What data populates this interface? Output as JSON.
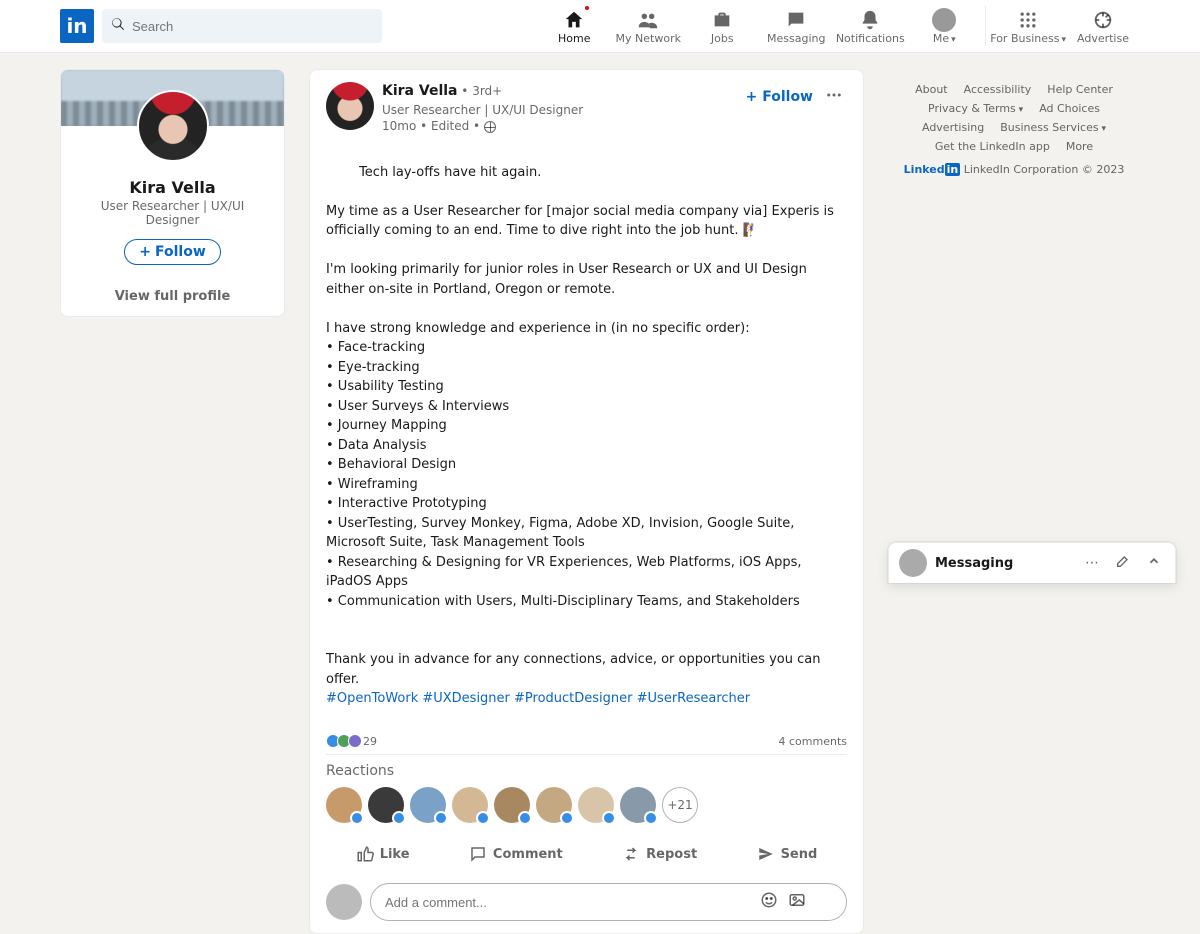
{
  "search": {
    "placeholder": "Search"
  },
  "nav": {
    "home": "Home",
    "network": "My Network",
    "jobs": "Jobs",
    "messaging": "Messaging",
    "notifications": "Notifications",
    "me": "Me",
    "business": "For Business",
    "advertise": "Advertise"
  },
  "profileCard": {
    "name": "Kira Vella",
    "headline": "User Researcher | UX/UI Designer",
    "follow": "Follow",
    "viewFull": "View full profile"
  },
  "post": {
    "author": "Kira Vella",
    "degree": " • 3rd+",
    "headline": "User Researcher | UX/UI Designer",
    "time": "10mo • Edited • ",
    "followLabel": "+ Follow",
    "body": "Tech lay-offs have hit again.\n\nMy time as a User Researcher for [major social media company via] Experis is officially coming to an end. Time to dive right into the job hunt. 🧗‍♀️\n\nI'm looking primarily for junior roles in User Research or UX and UI Design either on-site in Portland, Oregon or remote.\n\nI have strong knowledge and experience in (in no specific order):\n• Face-tracking\n• Eye-tracking\n• Usability Testing\n• User Surveys & Interviews\n• Journey Mapping\n• Data Analysis\n• Behavioral Design\n• Wireframing\n• Interactive Prototyping\n• UserTesting, Survey Monkey, Figma, Adobe XD, Invision, Google Suite, Microsoft Suite, Task Management Tools\n• Researching & Designing for VR Experiences, Web Platforms, iOS Apps, iPadOS Apps\n• Communication with Users, Multi-Disciplinary Teams, and Stakeholders\n\n\nThank you in advance for any connections, advice, or opportunities you can offer.",
    "hashtags": "#OpenToWork #UXDesigner #ProductDesigner #UserResearcher",
    "reactionsCount": "29",
    "commentsCount": "4 comments",
    "reactionsHeader": "Reactions",
    "reactorAvatarColors": [
      "#c79a6b",
      "#3a3a3a",
      "#7aa2c9",
      "#d4b896",
      "#a88860",
      "#c4a882",
      "#d8c4a8",
      "#8899aa"
    ],
    "moreReactions": "+21",
    "actions": {
      "like": "Like",
      "comment": "Comment",
      "repost": "Repost",
      "send": "Send"
    },
    "commentPlaceholder": "Add a comment..."
  },
  "footer": {
    "row1": [
      "About",
      "Accessibility",
      "Help Center"
    ],
    "row2": [
      "Privacy & Terms",
      "Ad Choices"
    ],
    "row3": [
      "Advertising",
      "Business Services"
    ],
    "row4": [
      "Get the LinkedIn app",
      "More"
    ],
    "brand": "LinkedIn Corporation © 2023"
  },
  "messaging": {
    "title": "Messaging"
  }
}
